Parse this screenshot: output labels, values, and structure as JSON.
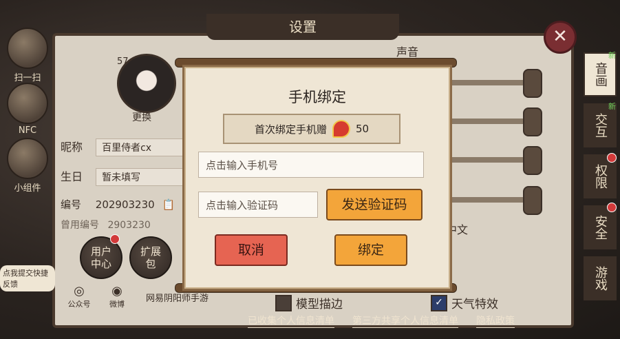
{
  "left_tools": [
    {
      "label": "扫一扫",
      "icon": "scan-icon"
    },
    {
      "label": "NFC",
      "icon": "nfc-icon"
    },
    {
      "label": "小组件",
      "icon": "widget-icon"
    }
  ],
  "panel": {
    "title": "设置",
    "avatar_level": "57",
    "avatar_change": "更换",
    "nickname_label": "昵称",
    "nickname_value": "百里侍者cx",
    "birthday_label": "生日",
    "birthday_value": "暂未填写",
    "id_label": "编号",
    "id_value": "202903230",
    "old_id_label": "曾用编号",
    "old_id_value": "2903230",
    "user_center": "用户\n中心",
    "expansion": "扩展\n包",
    "feedback_bubble": "点我提交快捷反馈",
    "social": [
      {
        "label": "公众号"
      },
      {
        "label": "微博"
      }
    ],
    "netease_text": "网易阴阳师手游",
    "sound_label": "声音",
    "language_value": "中文",
    "checkbox_model_outline": "模型描边",
    "checkbox_weather": "天气特效",
    "bottom_links": [
      "已收集个人信息清单",
      "第三方共享个人信息清单",
      "隐私政策"
    ]
  },
  "tabs": [
    {
      "label": "音画",
      "new": "新"
    },
    {
      "label": "交互",
      "new": "新"
    },
    {
      "label": "权限"
    },
    {
      "label": "安全"
    },
    {
      "label": "游戏"
    }
  ],
  "dialog": {
    "title": "手机绑定",
    "bonus_text": "首次绑定手机赠",
    "bonus_amount": "50",
    "phone_placeholder": "点击输入手机号",
    "code_placeholder": "点击输入验证码",
    "send_code": "发送验证码",
    "cancel": "取消",
    "bind": "绑定"
  },
  "colors": {
    "accent_orange": "#f3a53a",
    "cancel_red": "#e66452",
    "panel_bg": "#d9d1c4"
  }
}
